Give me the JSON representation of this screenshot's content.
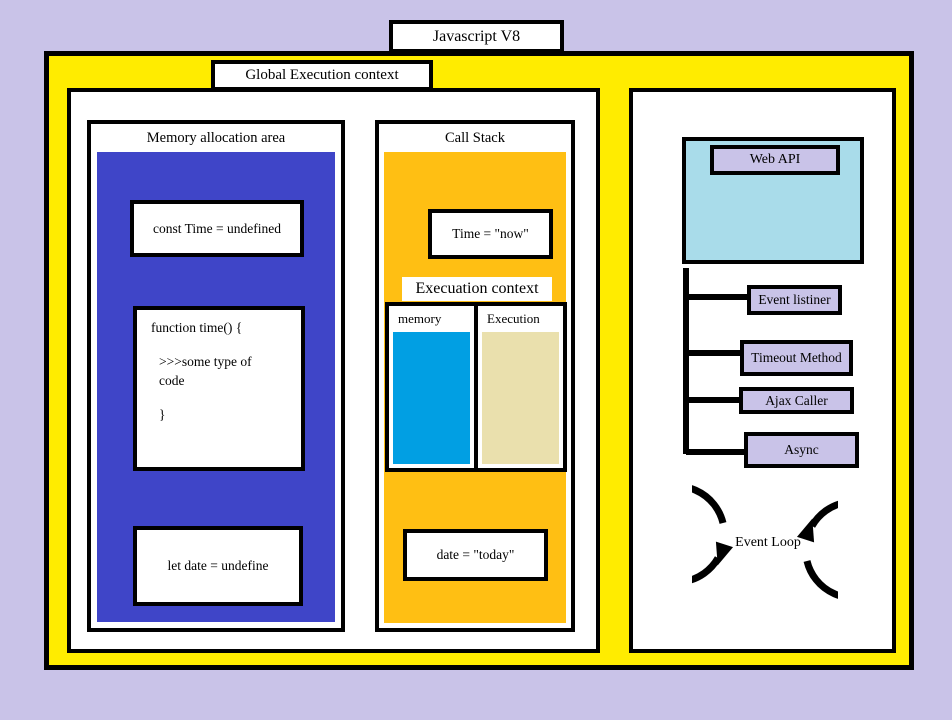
{
  "diagram": {
    "title": "Javascript V8",
    "global_context_label": "Global Execution context",
    "colors": {
      "page_background": "#c9c3e8",
      "engine_frame": "#ffec00",
      "memory_area": "#3f45c8",
      "call_stack": "#ffbf13",
      "exec_memory_col": "#019fe3",
      "exec_execution_col": "#eae0ad",
      "web_api_panel": "#a9dcea",
      "api_item": "#c9c3e8",
      "border": "#000000",
      "panel": "#ffffff"
    }
  },
  "memory_area": {
    "header": "Memory  allocation area",
    "items": [
      {
        "text": "const Time = undefined"
      },
      {
        "line1": "function time() {",
        "line2": ">>>some type of",
        "line3": "code",
        "line4": "}"
      },
      {
        "text": "let date = undefine"
      }
    ]
  },
  "call_stack": {
    "header": "Call Stack",
    "frames": [
      {
        "text": "Time = \"now\""
      },
      {
        "text": "date = \"today\""
      }
    ],
    "execution_context": {
      "label": "Execuation context",
      "columns": [
        {
          "header": "memory"
        },
        {
          "header": "Execution"
        }
      ]
    }
  },
  "runtime": {
    "web_api_label": "Web API",
    "api_items": [
      {
        "label": "Event listiner"
      },
      {
        "label": "Timeout Method"
      },
      {
        "label": "Ajax Caller"
      },
      {
        "label": "Async"
      }
    ],
    "event_loop_label": "Event Loop"
  }
}
